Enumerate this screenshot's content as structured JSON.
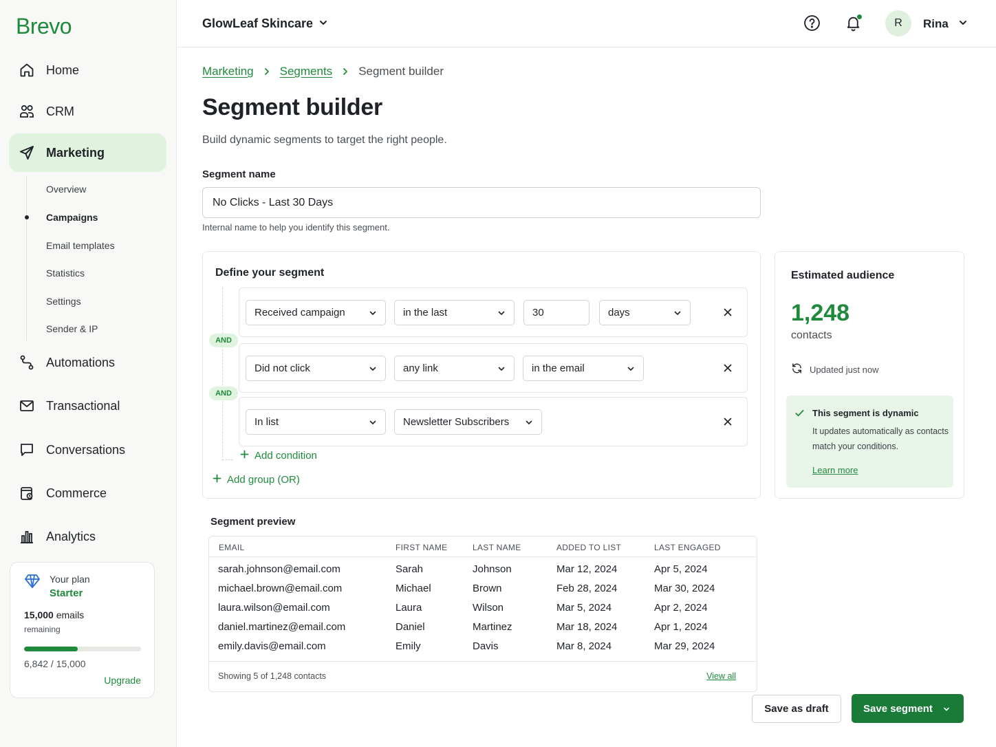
{
  "app": {
    "logo": "Brevo",
    "brand_color": "#1f8a3b"
  },
  "sidebar": {
    "items": [
      {
        "label": "Home",
        "icon": "home-icon"
      },
      {
        "label": "CRM",
        "icon": "users-icon"
      },
      {
        "label": "Marketing",
        "icon": "send-icon",
        "active": true
      },
      {
        "label": "Automations",
        "icon": "workflow-icon"
      },
      {
        "label": "Transactional",
        "icon": "mail-icon"
      },
      {
        "label": "Conversations",
        "icon": "chat-icon"
      },
      {
        "label": "Commerce",
        "icon": "store-icon"
      },
      {
        "label": "Analytics",
        "icon": "bar-chart-icon"
      }
    ],
    "sub_items": [
      {
        "label": "Overview"
      },
      {
        "label": "Campaigns",
        "active": true
      },
      {
        "label": "Email templates"
      },
      {
        "label": "Statistics"
      },
      {
        "label": "Settings"
      },
      {
        "label": "Sender & IP"
      }
    ],
    "plan": {
      "label": "Your plan",
      "name": "Starter",
      "emails_count": "15,000",
      "emails_word": "emails",
      "remaining": "remaining",
      "used_fraction": 0.4565,
      "usage": "6,842 / 15,000",
      "upgrade": "Upgrade"
    }
  },
  "topbar": {
    "workspace": "GlowLeaf Skincare",
    "avatar_initial": "R",
    "user_name": "Rina"
  },
  "breadcrumb": {
    "marketing": "Marketing",
    "segments": "Segments",
    "current": "Segment builder"
  },
  "page": {
    "title": "Segment builder",
    "subtitle": "Build dynamic segments to target the right people."
  },
  "segment_name": {
    "label": "Segment name",
    "value": "No Clicks - Last 30 Days",
    "help": "Internal name to help you identify this segment."
  },
  "define": {
    "title": "Define your segment",
    "and_label": "AND",
    "conditions": [
      {
        "field": "Received campaign",
        "operator": "in the last",
        "value": "30",
        "unit": "days"
      },
      {
        "field": "Did not click",
        "operator": "any link",
        "scope": "in the email"
      },
      {
        "field": "In list",
        "list": "Newsletter Subscribers"
      }
    ],
    "add_condition": "Add condition",
    "add_group": "Add group (OR)"
  },
  "audience": {
    "title": "Estimated audience",
    "count": "1,248",
    "unit": "contacts",
    "updated": "Updated just now",
    "dynamic_title": "This segment is dynamic",
    "dynamic_text": "It updates automatically as contacts match your conditions.",
    "learn_more": "Learn more"
  },
  "preview": {
    "title": "Segment preview",
    "columns": [
      "EMAIL",
      "FIRST NAME",
      "LAST NAME",
      "ADDED TO LIST",
      "LAST ENGAGED"
    ],
    "rows": [
      [
        "sarah.johnson@email.com",
        "Sarah",
        "Johnson",
        "Mar 12, 2024",
        "Apr 5, 2024"
      ],
      [
        "michael.brown@email.com",
        "Michael",
        "Brown",
        "Feb 28, 2024",
        "Mar 30, 2024"
      ],
      [
        "laura.wilson@email.com",
        "Laura",
        "Wilson",
        "Mar 5, 2024",
        "Apr 2, 2024"
      ],
      [
        "daniel.martinez@email.com",
        "Daniel",
        "Martinez",
        "Mar 18, 2024",
        "Apr 1, 2024"
      ],
      [
        "emily.davis@email.com",
        "Emily",
        "Davis",
        "Mar 8, 2024",
        "Mar 29, 2024"
      ]
    ],
    "footer": "Showing 5 of 1,248 contacts",
    "view_all": "View all"
  },
  "actions": {
    "save_draft": "Save as draft",
    "save_segment": "Save segment"
  }
}
